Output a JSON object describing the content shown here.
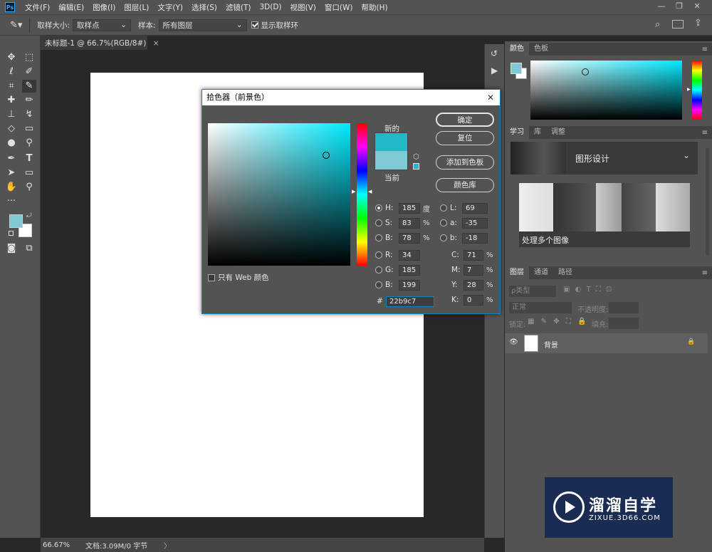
{
  "app": {
    "logo": "Ps"
  },
  "menu": [
    "文件(F)",
    "编辑(E)",
    "图像(I)",
    "图层(L)",
    "文字(Y)",
    "选择(S)",
    "滤镜(T)",
    "3D(D)",
    "视图(V)",
    "窗口(W)",
    "帮助(H)"
  ],
  "window_controls": {
    "minimize": "—",
    "restore": "❐",
    "close": "✕"
  },
  "options": {
    "sample_size_label": "取样大小:",
    "sample_size_value": "取样点",
    "sample_label": "样本:",
    "sample_value": "所有图层",
    "show_ring_label": "显示取样环",
    "show_ring_checked": true
  },
  "document": {
    "tab_title": "未标题-1 @ 66.7%(RGB/8#)",
    "tab_close": "×",
    "zoom": "66.67%",
    "doc_info": "文档:3.09M/0 字节",
    "status_arrow": "〉"
  },
  "colors": {
    "foreground": "#7fc9d2",
    "background": "#ffffff",
    "new_color": "#22b9c7",
    "current_color": "#7fc9d2",
    "accent": "#1a80b6"
  },
  "picker": {
    "title": "拾色器（前景色）",
    "close": "✕",
    "new_label": "新的",
    "current_label": "当前",
    "web_only_label": "只有 Web 颜色",
    "buttons": {
      "ok": "确定",
      "reset": "复位",
      "add_swatch": "添加到色板",
      "color_lib": "颜色库"
    },
    "hsb": [
      {
        "label": "H:",
        "value": "185",
        "unit": "度",
        "selected": true
      },
      {
        "label": "S:",
        "value": "83",
        "unit": "%",
        "selected": false
      },
      {
        "label": "B:",
        "value": "78",
        "unit": "%",
        "selected": false
      }
    ],
    "rgb": [
      {
        "label": "R:",
        "value": "34"
      },
      {
        "label": "G:",
        "value": "185"
      },
      {
        "label": "B:",
        "value": "199"
      }
    ],
    "lab": [
      {
        "label": "L:",
        "value": "69"
      },
      {
        "label": "a:",
        "value": "-35"
      },
      {
        "label": "b:",
        "value": "-18"
      }
    ],
    "cmyk": [
      {
        "label": "C:",
        "value": "71",
        "unit": "%"
      },
      {
        "label": "M:",
        "value": "7",
        "unit": "%"
      },
      {
        "label": "Y:",
        "value": "28",
        "unit": "%"
      },
      {
        "label": "K:",
        "value": "0",
        "unit": "%"
      }
    ],
    "hex_label": "#",
    "hex_value": "22b9c7",
    "hue_degrees": 185
  },
  "color_panel": {
    "tabs": [
      "颜色",
      "色板"
    ]
  },
  "learn_panel": {
    "tabs": [
      "学习",
      "库",
      "调整"
    ],
    "header": "图形设计",
    "card_title": "处理多个图像"
  },
  "layers_panel": {
    "tabs": [
      "图层",
      "通道",
      "路径"
    ],
    "kind_label": "ρ类型",
    "blend_mode": "正常",
    "opacity_label": "不透明度:",
    "lock_label": "锁定:",
    "fill_label": "填充:",
    "layer_name": "背景",
    "filter_icons": [
      "▣",
      "◐",
      "T",
      "⛶",
      "⊡"
    ],
    "lock_icons": [
      "▦",
      "✎",
      "✥",
      "⛶",
      "🔒"
    ]
  },
  "watermark": {
    "title": "溜溜自学",
    "url": "ZIXUE.3D66.COM"
  }
}
